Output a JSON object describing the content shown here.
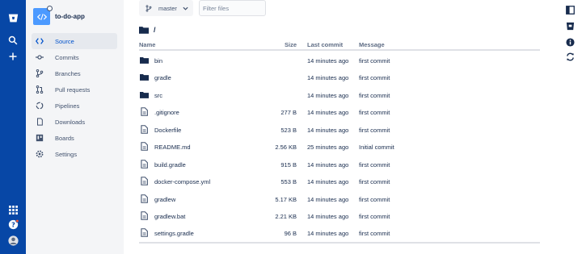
{
  "colors": {
    "global_nav": "#0747a6",
    "sidebar_bg": "#f4f5f7",
    "active_text": "#0052cc",
    "text": "#172b4d",
    "muted": "#5e6c84"
  },
  "global_nav": {
    "icons": [
      "bitbucket-logo-icon",
      "search-icon",
      "plus-icon",
      "app-switcher-icon",
      "help-icon",
      "user-avatar-icon"
    ]
  },
  "project": {
    "name": "to-do-app",
    "avatar_icon": "code-icon"
  },
  "sidebar": {
    "items": [
      {
        "label": "Source",
        "icon": "source-icon",
        "active": true
      },
      {
        "label": "Commits",
        "icon": "commits-icon",
        "active": false
      },
      {
        "label": "Branches",
        "icon": "branches-icon",
        "active": false
      },
      {
        "label": "Pull requests",
        "icon": "pull-requests-icon",
        "active": false
      },
      {
        "label": "Pipelines",
        "icon": "pipelines-icon",
        "active": false
      },
      {
        "label": "Downloads",
        "icon": "downloads-icon",
        "active": false
      },
      {
        "label": "Boards",
        "icon": "boards-icon",
        "active": false
      },
      {
        "label": "Settings",
        "icon": "settings-icon",
        "active": false
      }
    ]
  },
  "toolbar": {
    "branch": "master",
    "filter_placeholder": "Filter files"
  },
  "path": "/",
  "table": {
    "headers": {
      "name": "Name",
      "size": "Size",
      "last_commit": "Last commit",
      "message": "Message"
    },
    "rows": [
      {
        "type": "folder",
        "name": "bin",
        "size": "",
        "last_commit": "14 minutes ago",
        "message": "first commit"
      },
      {
        "type": "folder",
        "name": "gradle",
        "size": "",
        "last_commit": "14 minutes ago",
        "message": "first commit"
      },
      {
        "type": "folder",
        "name": "src",
        "size": "",
        "last_commit": "14 minutes ago",
        "message": "first commit"
      },
      {
        "type": "file",
        "name": ".gitignore",
        "size": "277 B",
        "last_commit": "14 minutes ago",
        "message": "first commit"
      },
      {
        "type": "file",
        "name": "Dockerfile",
        "size": "523 B",
        "last_commit": "14 minutes ago",
        "message": "first commit"
      },
      {
        "type": "file",
        "name": "README.md",
        "size": "2.56 KB",
        "last_commit": "25 minutes ago",
        "message": "Initial commit"
      },
      {
        "type": "file",
        "name": "build.gradle",
        "size": "915 B",
        "last_commit": "14 minutes ago",
        "message": "first commit"
      },
      {
        "type": "file",
        "name": "docker-compose.yml",
        "size": "553 B",
        "last_commit": "14 minutes ago",
        "message": "first commit"
      },
      {
        "type": "file",
        "name": "gradlew",
        "size": "5.17 KB",
        "last_commit": "14 minutes ago",
        "message": "first commit"
      },
      {
        "type": "file",
        "name": "gradlew.bat",
        "size": "2.21 KB",
        "last_commit": "14 minutes ago",
        "message": "first commit"
      },
      {
        "type": "file",
        "name": "settings.gradle",
        "size": "96 B",
        "last_commit": "14 minutes ago",
        "message": "first commit"
      }
    ]
  },
  "right_bar": {
    "icons": [
      "sidebar-toggle-icon",
      "repository-icon",
      "info-icon",
      "sync-icon"
    ]
  }
}
